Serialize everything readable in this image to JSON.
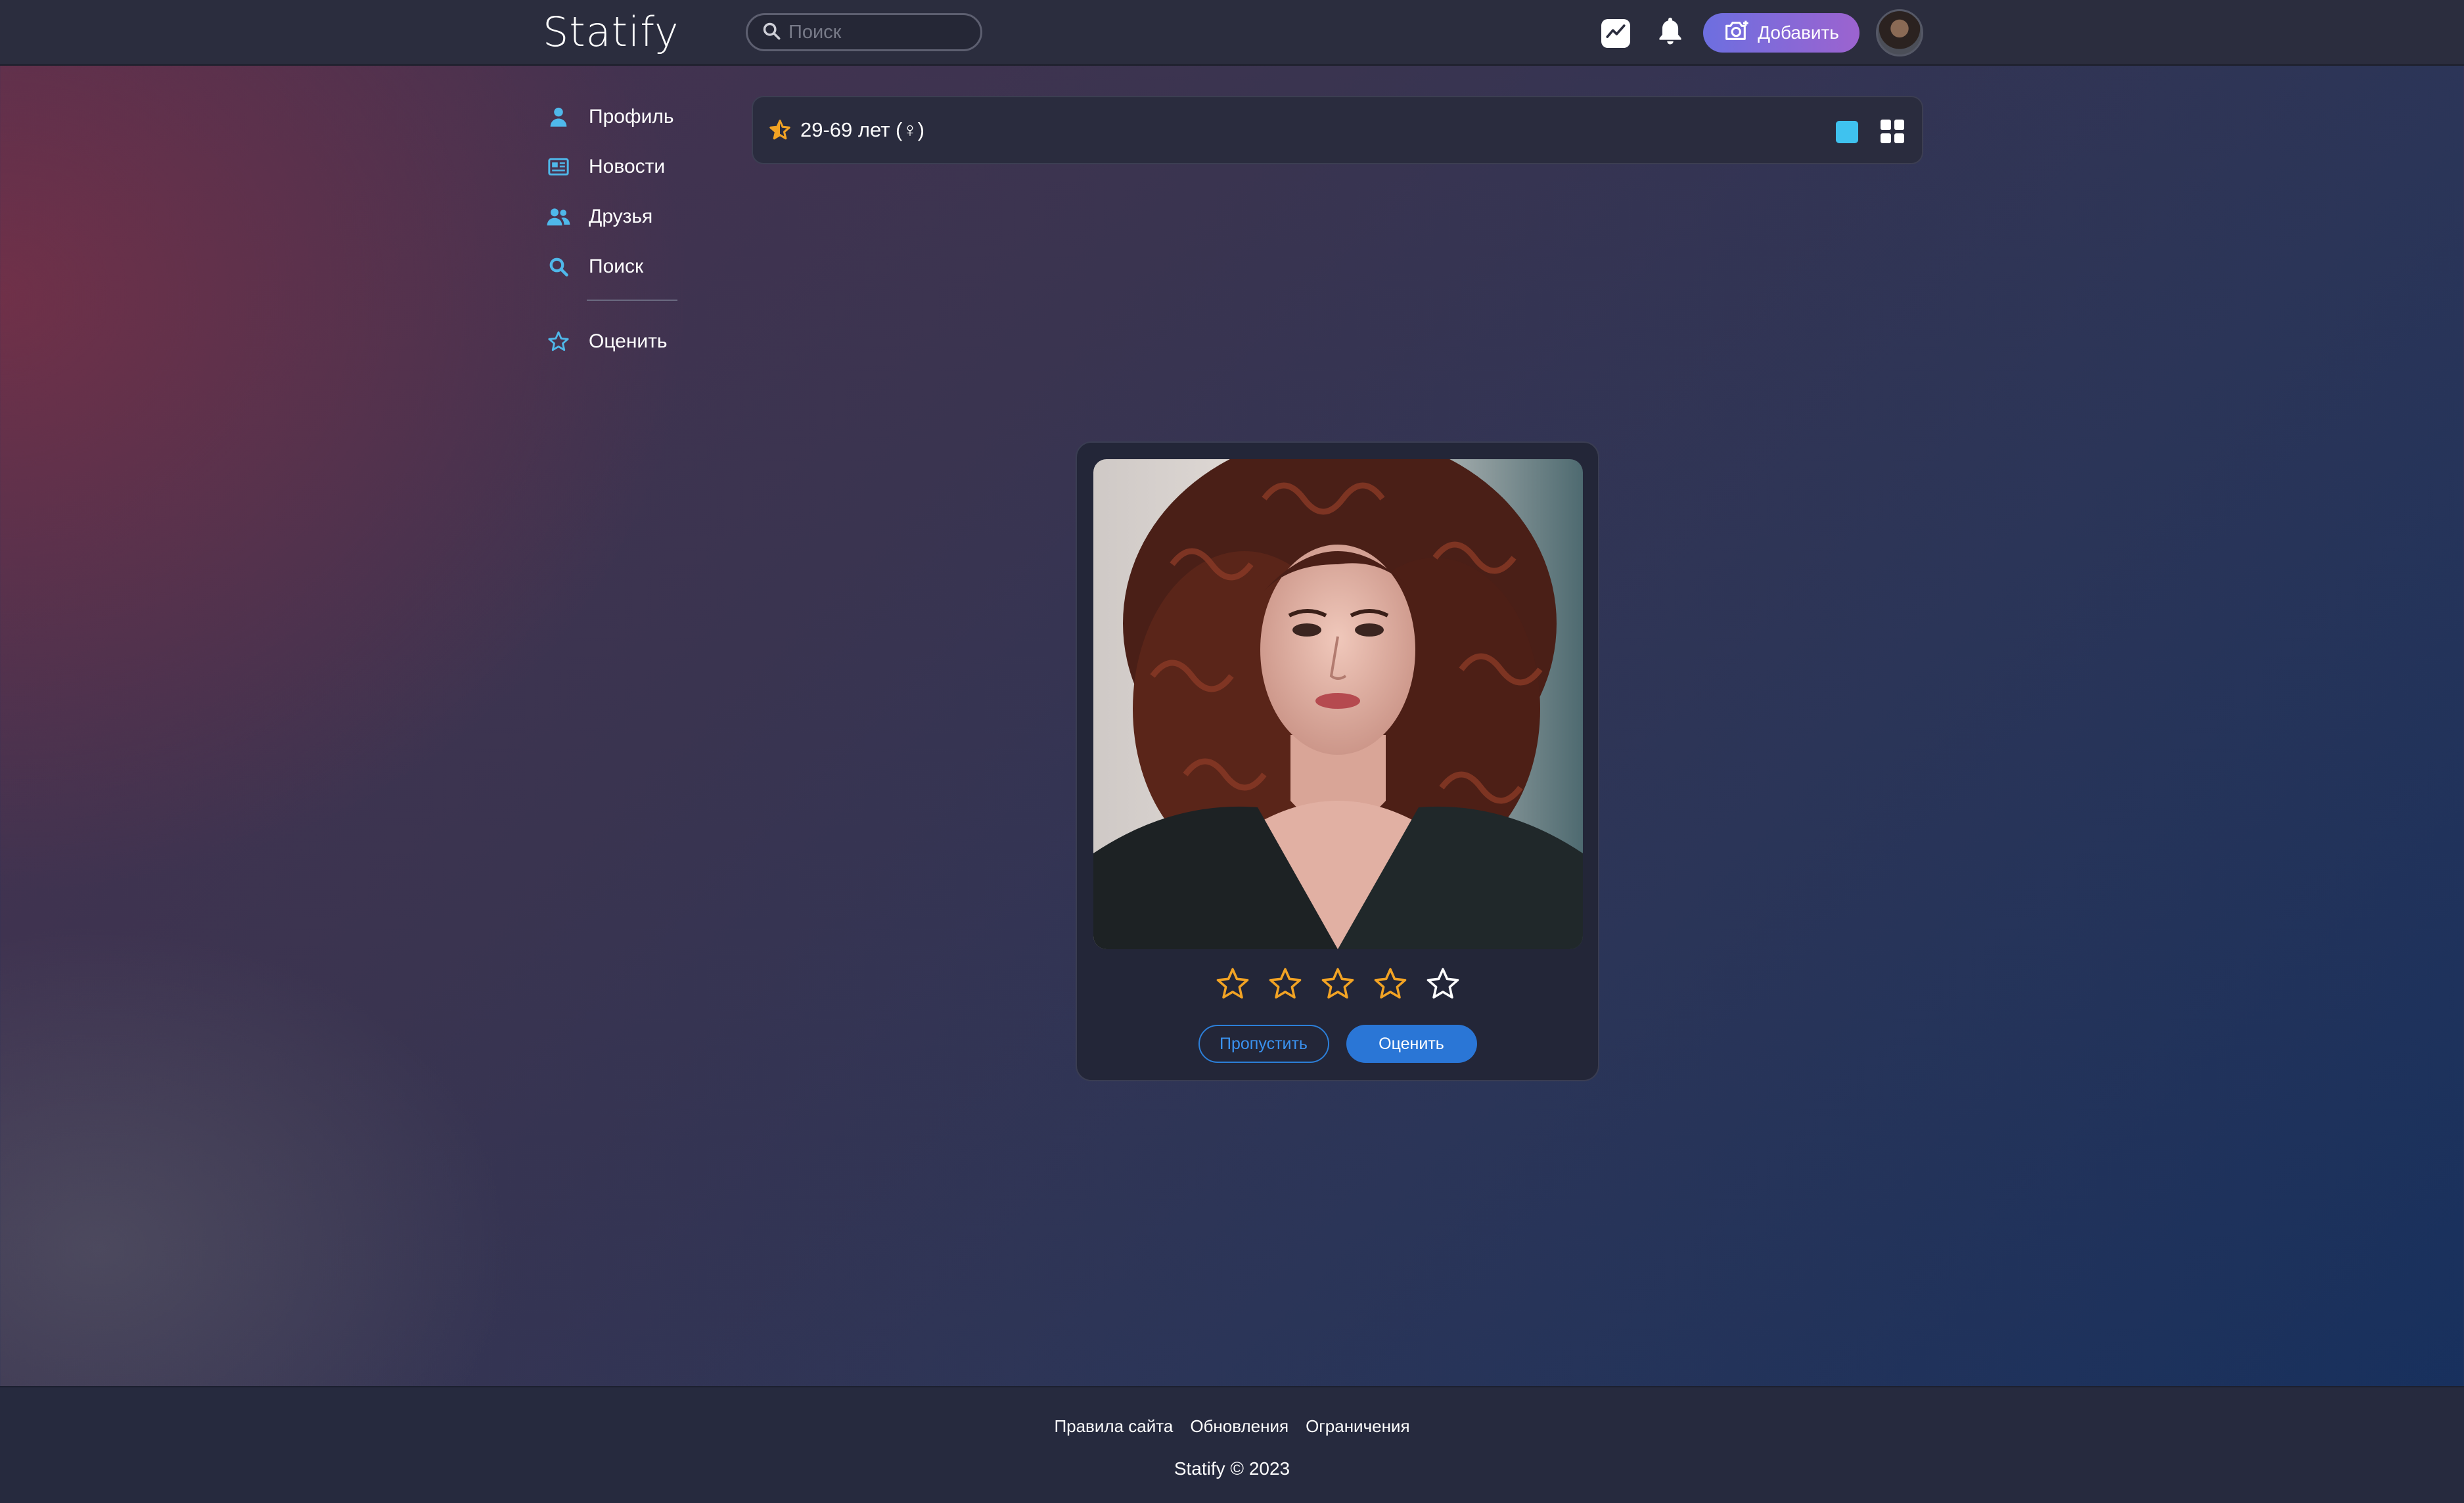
{
  "app": {
    "logo": "Statify"
  },
  "header": {
    "search_placeholder": "Поиск",
    "add_label": "Добавить"
  },
  "sidebar": {
    "items": [
      {
        "label": "Профиль",
        "icon": "user-icon"
      },
      {
        "label": "Новости",
        "icon": "newspaper-icon"
      },
      {
        "label": "Друзья",
        "icon": "friends-icon"
      },
      {
        "label": "Поиск",
        "icon": "search-icon"
      },
      {
        "label": "Оценить",
        "icon": "star-outline-icon"
      }
    ]
  },
  "filter": {
    "label": "29-69 лет (♀)",
    "view_modes": [
      "single",
      "grid"
    ],
    "active_view": "single"
  },
  "card": {
    "stars_total": 5,
    "skip_label": "Пропустить",
    "rate_label": "Оценить"
  },
  "footer": {
    "links": [
      "Правила сайта",
      "Обновления",
      "Ограничения"
    ],
    "copyright": "Statify © 2023"
  },
  "colors": {
    "accent_blue": "#2a76d6",
    "star_gold": "#f2a324",
    "sidebar_icon": "#4fb8ea",
    "add_button_gradient": [
      "#6d6fe0",
      "#9c63cf"
    ]
  }
}
